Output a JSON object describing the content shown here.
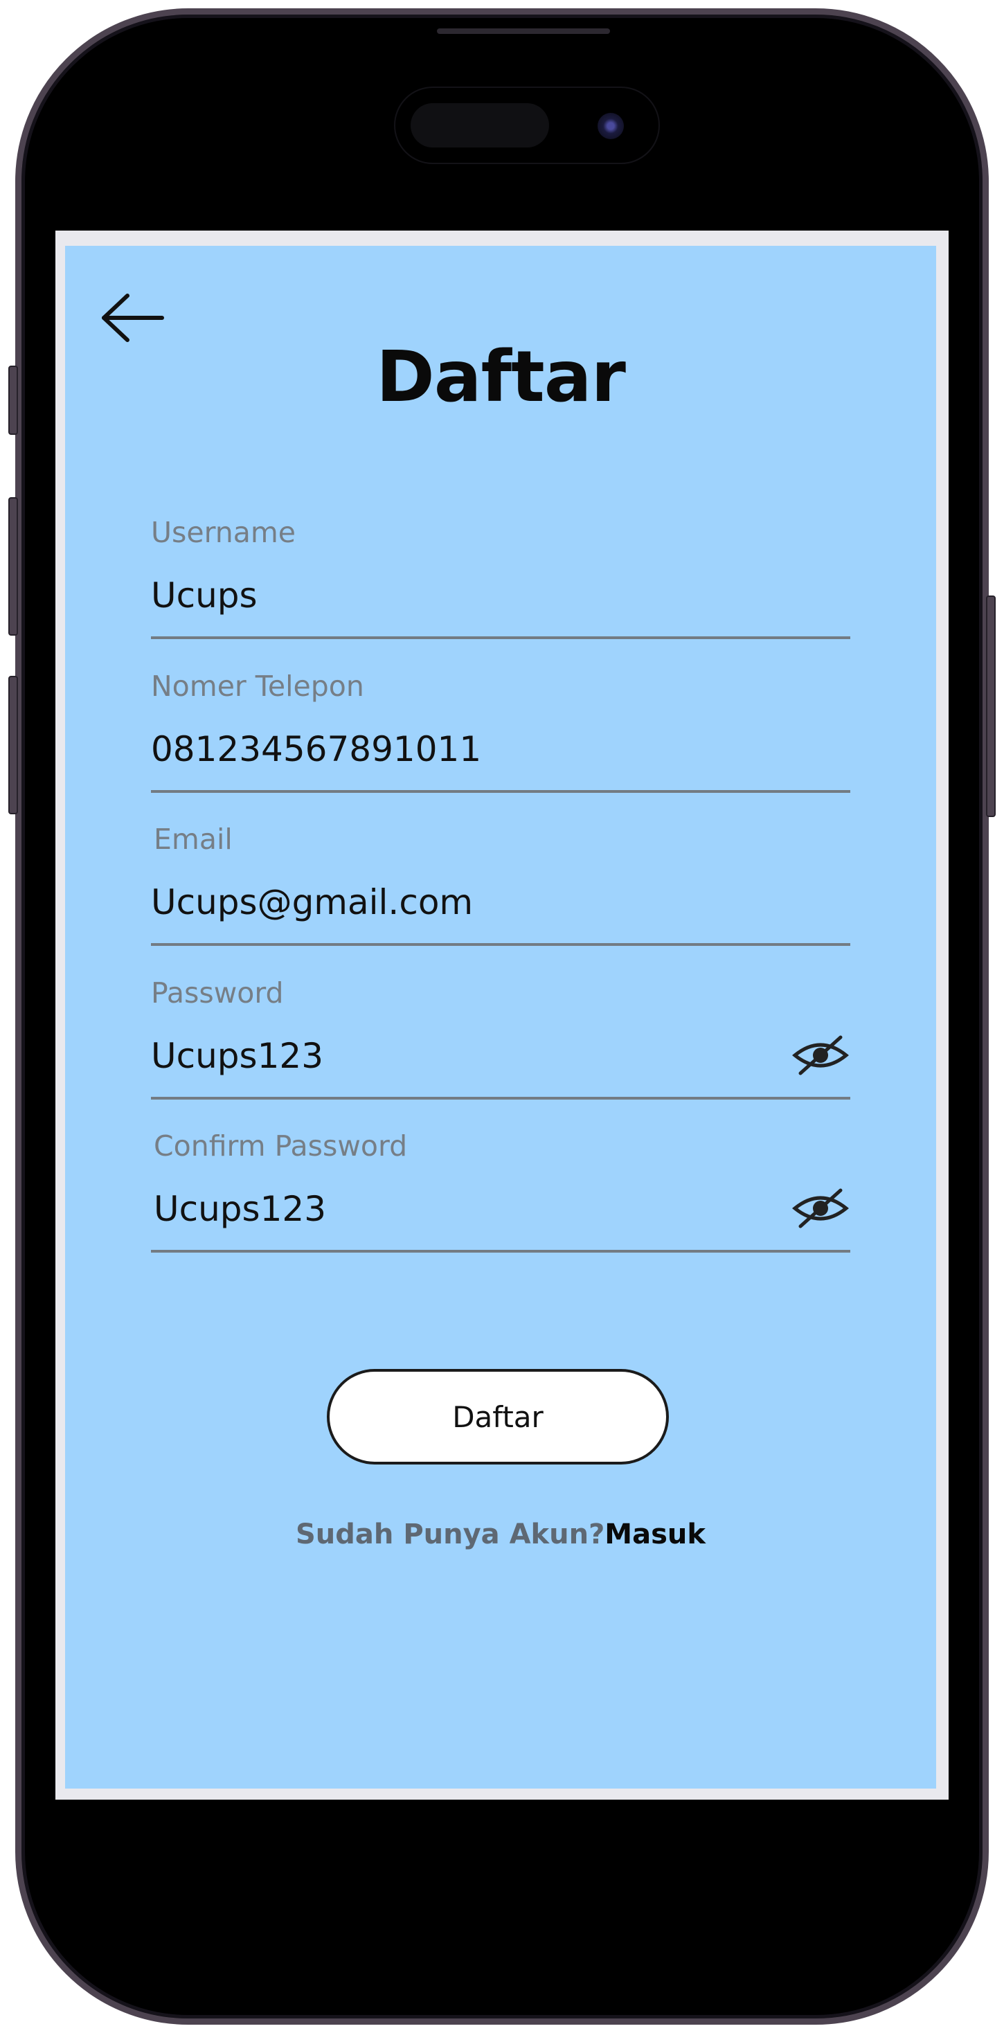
{
  "screen": {
    "title": "Daftar",
    "background_color": "#9fd3fd"
  },
  "form": {
    "fields": [
      {
        "label": "Username",
        "value": "Ucups"
      },
      {
        "label": "Nomer Telepon",
        "value": "081234567891011"
      },
      {
        "label": "Email",
        "value": "Ucups@gmail.com"
      },
      {
        "label": "Password",
        "value": "Ucups123",
        "icon": "eye-slash-icon"
      },
      {
        "label": "Confirm Password",
        "value": "Ucups123",
        "icon": "eye-slash-icon"
      }
    ],
    "submit_label": "Daftar"
  },
  "footer": {
    "prompt": "Sudah Punya Akun?",
    "link": "Masuk"
  },
  "icons": {
    "back": "arrow-left-icon",
    "toggle_visibility": "eye-slash-icon"
  }
}
